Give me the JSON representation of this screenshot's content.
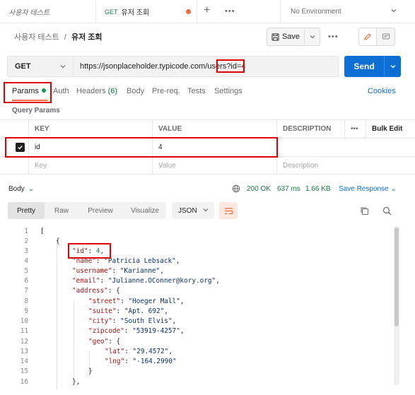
{
  "tabs": {
    "tab1_label": "사용자 테스트",
    "tab2_method": "GET",
    "tab2_label": "유저 조회",
    "more": "•••",
    "environment": "No Environment"
  },
  "header": {
    "breadcrumb_parent": "사용자 테스트",
    "separator": "/",
    "breadcrumb_current": "유저 조회",
    "save_label": "Save",
    "more": "•••"
  },
  "request": {
    "method": "GET",
    "url_base": "https://jsonplaceholder.typicode.com/users",
    "url_query": "?id=4",
    "send_label": "Send"
  },
  "request_tabs": [
    {
      "label": "Params"
    },
    {
      "label": "Auth"
    },
    {
      "label": "Headers",
      "count": "(6)"
    },
    {
      "label": "Body"
    },
    {
      "label": "Pre-req."
    },
    {
      "label": "Tests"
    },
    {
      "label": "Settings"
    }
  ],
  "cookies_label": "Cookies",
  "query_params_title": "Query Params",
  "params_table": {
    "headers": [
      "KEY",
      "VALUE",
      "DESCRIPTION",
      "•••",
      "Bulk Edit"
    ],
    "rows": [
      {
        "checked": true,
        "key": "id",
        "value": "4",
        "description": ""
      }
    ],
    "placeholder": {
      "key": "Key",
      "value": "Value",
      "description": "Description"
    }
  },
  "response": {
    "body_label": "Body",
    "status": "200 OK",
    "time": "637 ms",
    "size": "1.66 KB",
    "save_response": "Save Response",
    "view_tabs": [
      "Pretty",
      "Raw",
      "Preview",
      "Visualize"
    ],
    "format": "JSON"
  },
  "code_lines": [
    "1",
    "2",
    "3",
    "4",
    "5",
    "6",
    "7",
    "8",
    "9",
    "10",
    "11",
    "12",
    "13",
    "14",
    "15",
    "16"
  ],
  "json": {
    "id": "4",
    "name": "\"Patricia Lebsack\"",
    "username": "\"Karianne\"",
    "email": "\"Julianne.OConner@kory.org\"",
    "street": "\"Hoeger Mall\"",
    "suite": "\"Apt. 692\"",
    "city": "\"South Elvis\"",
    "zipcode": "\"53919-4257\"",
    "lat": "\"29.4572\"",
    "lng": "\"-164.2990\""
  },
  "colors": {
    "accent": "#0d6fd6",
    "method_get": "#0f7b3e",
    "highlight": "#e00000",
    "active_tab": "#f26b3a"
  }
}
